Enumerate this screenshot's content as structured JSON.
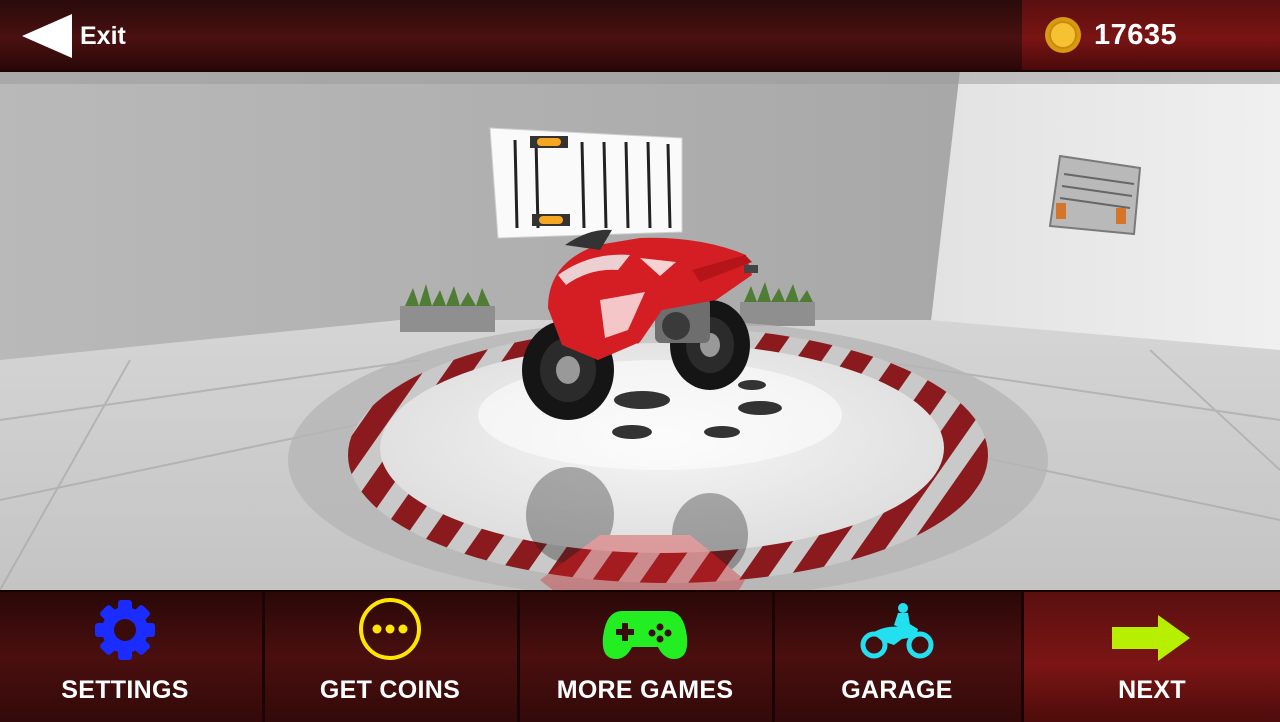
{
  "header": {
    "exit_label": "Exit",
    "coin_count": "17635"
  },
  "menu": [
    {
      "id": "settings",
      "label": "SETTINGS",
      "icon": "gear-icon",
      "color": "#1a2cff"
    },
    {
      "id": "get-coins",
      "label": "GET COINS",
      "icon": "ellipsis-circle-icon",
      "color": "#ffe600"
    },
    {
      "id": "more-games",
      "label": "MORE GAMES",
      "icon": "gamepad-icon",
      "color": "#22ee22"
    },
    {
      "id": "garage",
      "label": "GARAGE",
      "icon": "motorbike-icon",
      "color": "#22e0f0"
    },
    {
      "id": "next",
      "label": "NEXT",
      "icon": "arrow-right-icon",
      "color": "#b6f000"
    }
  ],
  "colors": {
    "bar": "#3a0c0c",
    "panel": "#6e1212",
    "bike": "#d41e24"
  }
}
